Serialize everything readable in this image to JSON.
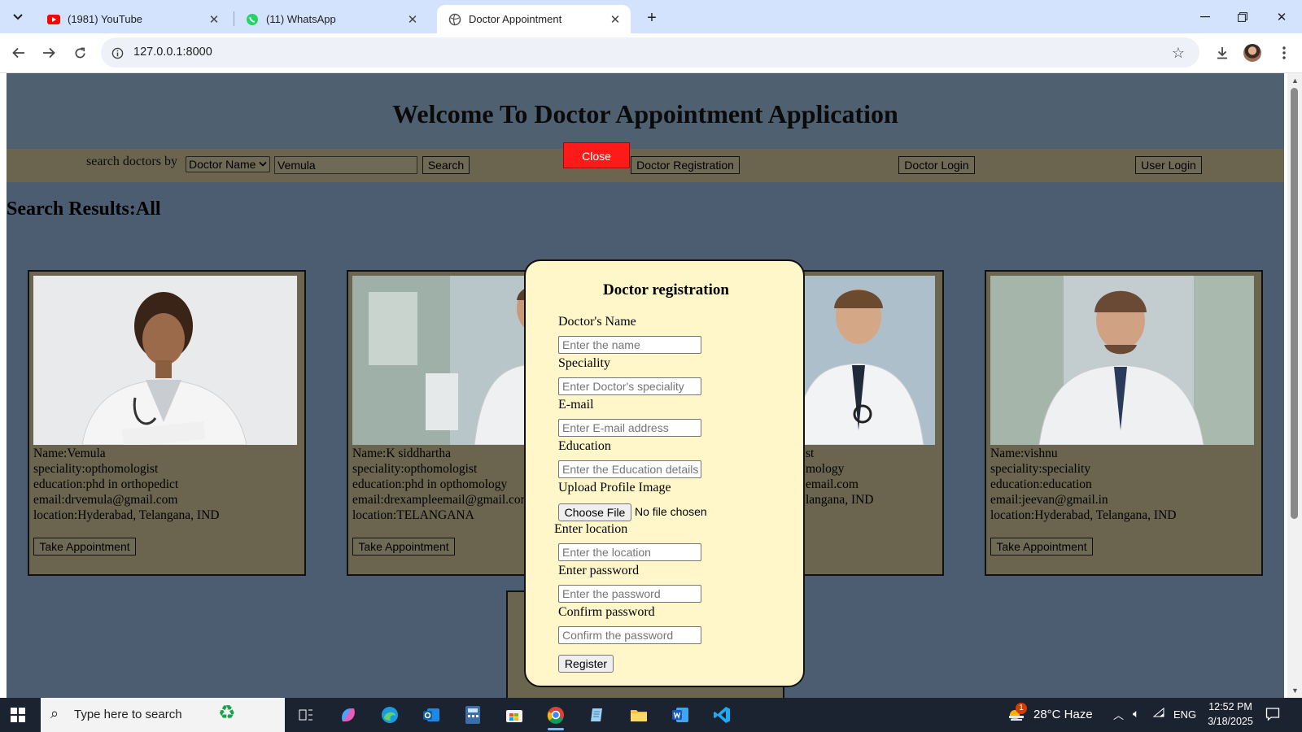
{
  "browser": {
    "tabs": [
      {
        "label": "(1981) YouTube",
        "icon": "youtube-icon",
        "active": false
      },
      {
        "label": "(11) WhatsApp",
        "icon": "whatsapp-icon",
        "active": false
      },
      {
        "label": "Doctor Appointment",
        "icon": "globe-icon",
        "active": true
      }
    ],
    "url": "127.0.0.1:8000"
  },
  "page": {
    "title": "Welcome To Doctor Appointment Application",
    "search": {
      "label": "search doctors by",
      "select_value": "Doctor Name",
      "input_value": "Vemula",
      "button": "Search"
    },
    "nav": {
      "close": "Close",
      "doctor_registration": "Doctor Registration",
      "doctor_login": "Doctor Login",
      "user_login": "User Login"
    },
    "results_title": "Search Results:All",
    "cards": [
      {
        "name": "Name:Vemula",
        "speciality": "speciality:opthomologist",
        "education": "education:phd in orthopedict",
        "email": "email:drvemula@gmail.com",
        "location": "location:Hyderabad, Telangana, IND",
        "button": "Take Appointment"
      },
      {
        "name": "Name:K siddhartha",
        "speciality": "speciality:opthomologist",
        "education": "education:phd in opthomology",
        "email": "email:drexampleemail@gmail.com",
        "location": "location:TELANGANA",
        "button": "Take Appointment"
      },
      {
        "name": "",
        "speciality": "st",
        "education": "mology",
        "email": "email.com",
        "location": "langana, IND",
        "button": ""
      },
      {
        "name": "Name:vishnu",
        "speciality": "speciality:speciality",
        "education": "education:education",
        "email": "email:jeevan@gmail.in",
        "location": "location:Hyderabad, Telangana, IND",
        "button": "Take Appointment"
      }
    ]
  },
  "modal": {
    "title": "Doctor registration",
    "fields": [
      {
        "label": "Doctor's Name",
        "placeholder": "Enter the name"
      },
      {
        "label": "Speciality",
        "placeholder": "Enter Doctor's speciality"
      },
      {
        "label": "E-mail",
        "placeholder": "Enter E-mail address"
      },
      {
        "label": "Education",
        "placeholder": "Enter the Education details"
      }
    ],
    "upload": {
      "label": "Upload Profile Image",
      "button": "Choose File",
      "status": "No file chosen"
    },
    "fields2": [
      {
        "label": "Enter location",
        "placeholder": "Enter the location"
      },
      {
        "label": "Enter password",
        "placeholder": "Enter the password"
      },
      {
        "label": "Confirm password",
        "placeholder": "Confirm the password"
      }
    ],
    "submit": "Register"
  },
  "taskbar": {
    "search_placeholder": "Type here to search",
    "weather": "28°C  Haze",
    "weather_badge": "1",
    "language": "ENG",
    "time": "12:52 PM",
    "date": "3/18/2025"
  },
  "colors": {
    "page_bg": "#4c5d72",
    "navbar_bg": "#6b654f",
    "modal_bg": "#fff7c9",
    "close_button": "#ff1a1a"
  }
}
